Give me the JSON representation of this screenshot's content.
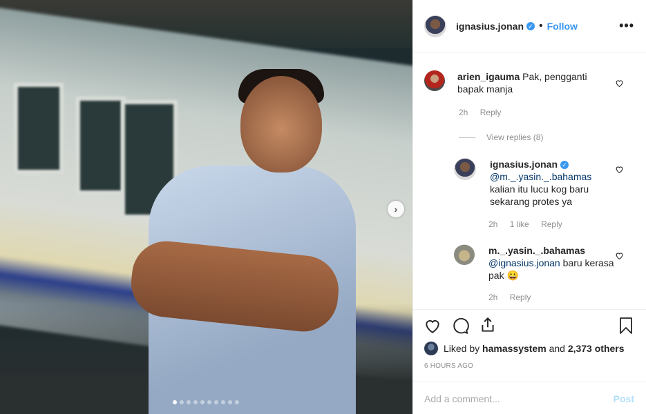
{
  "post": {
    "username": "ignasius.jonan",
    "follow_label": "Follow",
    "separator": "•",
    "more_label": "•••",
    "carousel": {
      "total_slides": 10,
      "active_slide": 1
    }
  },
  "comments": [
    {
      "username": "arien_igauma",
      "text": "Pak, pengganti bapak manja",
      "time": "2h",
      "reply_label": "Reply"
    }
  ],
  "view_replies": "View replies (8)",
  "replies": [
    {
      "username": "ignasius.jonan",
      "mention": "@m._.yasin._.bahamas",
      "text": "kalian itu lucu kog baru sekarang protes ya",
      "time": "2h",
      "likes": "1 like",
      "reply_label": "Reply"
    },
    {
      "username": "m._.yasin._.bahamas",
      "mention": "@ignasius.jonan",
      "text": "baru kerasa pak",
      "emoji": "😀",
      "time": "2h",
      "reply_label": "Reply"
    }
  ],
  "liked_by": {
    "prefix": "Liked by",
    "user": "hamassystem",
    "middle": "and",
    "count": "2,373 others"
  },
  "time_ago": "6 HOURS AGO",
  "add_comment": {
    "placeholder": "Add a comment...",
    "post_label": "Post"
  },
  "colors": {
    "accent": "#3897f0",
    "mention": "#003569",
    "muted": "#8e8e8e"
  }
}
